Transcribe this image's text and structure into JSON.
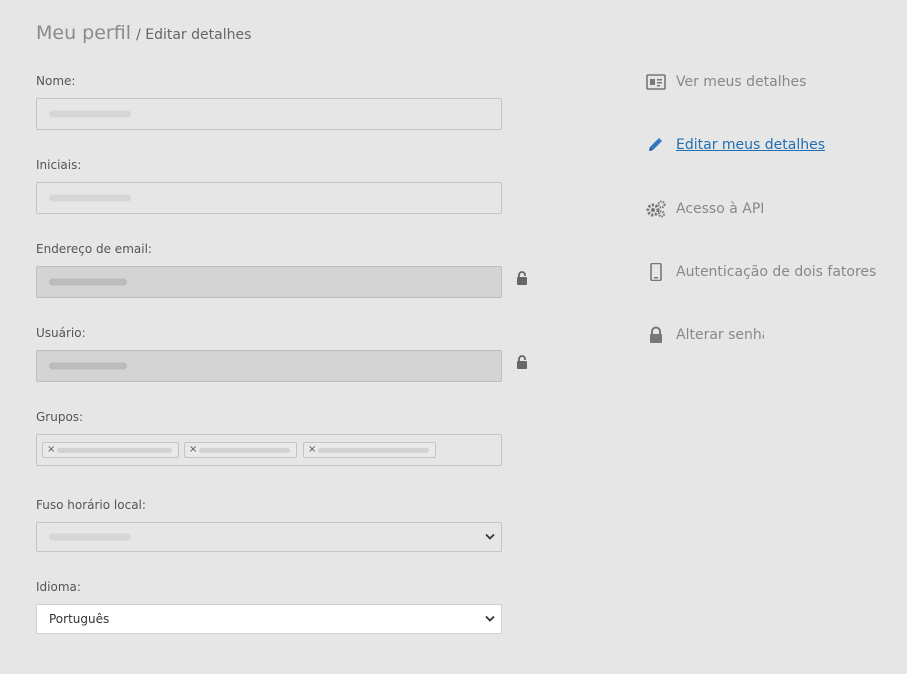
{
  "header": {
    "title": "Meu perfil",
    "subtitle": "/ Editar detalhes"
  },
  "form": {
    "name_label": "Nome:",
    "initials_label": "Iniciais:",
    "email_label": "Endereço de email:",
    "user_label": "Usuário:",
    "groups_label": "Grupos:",
    "timezone_label": "Fuso horário local:",
    "language_label": "Idioma:",
    "language_value": "Português",
    "tag_remove_symbol": "×"
  },
  "menu": {
    "items": [
      {
        "label": "Ver meus detalhes",
        "icon": "id-card-icon",
        "active": false
      },
      {
        "label": "Editar meus detalhes",
        "icon": "pencil-icon",
        "active": true
      },
      {
        "label": "Acesso à API",
        "icon": "gears-icon",
        "active": false
      },
      {
        "label": "Autenticação de dois fatores",
        "icon": "mobile-phone-icon",
        "active": false
      },
      {
        "label": "Alterar senha",
        "icon": "lock-icon",
        "active": false
      }
    ]
  },
  "colors": {
    "background": "#e6e6e6",
    "active_link": "#1f6fb2",
    "muted_text": "#888888"
  }
}
